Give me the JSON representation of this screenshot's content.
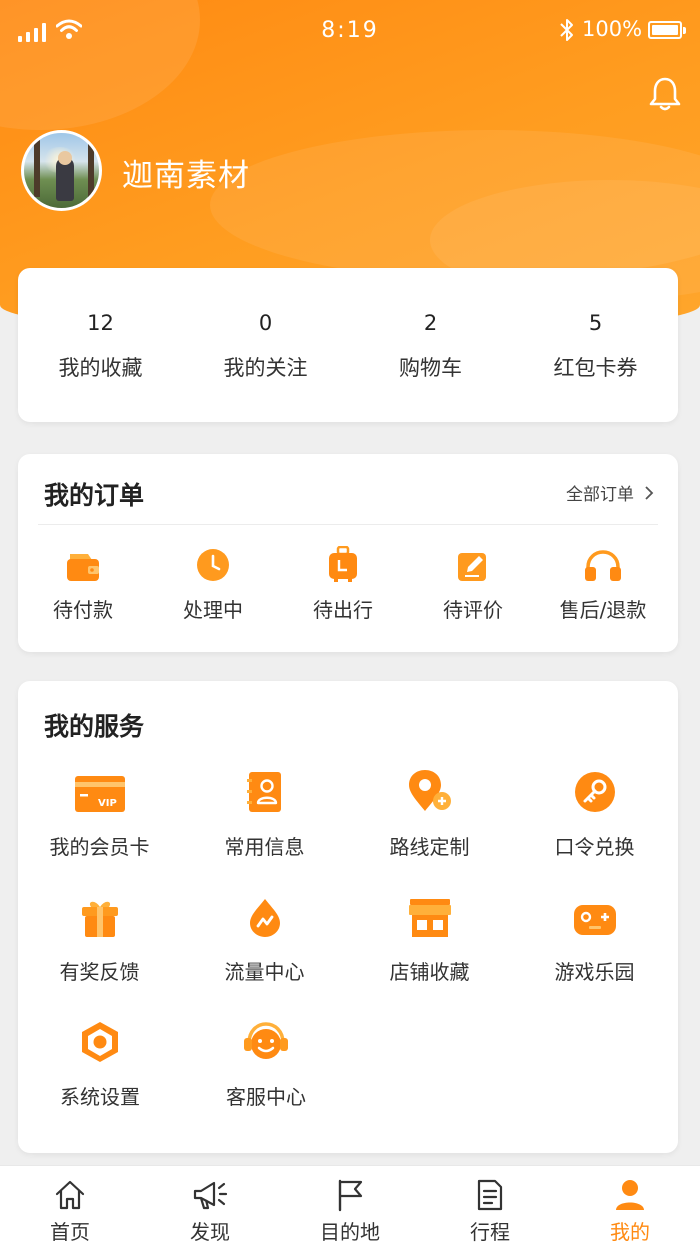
{
  "status_bar": {
    "time": "8:19",
    "battery": "100%"
  },
  "profile": {
    "username": "迦南素材"
  },
  "stats": [
    {
      "count": "12",
      "label": "我的收藏"
    },
    {
      "count": "0",
      "label": "我的关注"
    },
    {
      "count": "2",
      "label": "购物车"
    },
    {
      "count": "5",
      "label": "红包卡券"
    }
  ],
  "orders": {
    "title": "我的订单",
    "all_label": "全部订单",
    "items": [
      {
        "label": "待付款",
        "icon": "wallet-icon"
      },
      {
        "label": "处理中",
        "icon": "clock-icon"
      },
      {
        "label": "待出行",
        "icon": "luggage-icon"
      },
      {
        "label": "待评价",
        "icon": "edit-icon"
      },
      {
        "label": "售后/退款",
        "icon": "headphones-icon"
      }
    ]
  },
  "services": {
    "title": "我的服务",
    "items": [
      {
        "label": "我的会员卡",
        "icon": "vip-card-icon"
      },
      {
        "label": "常用信息",
        "icon": "contacts-icon"
      },
      {
        "label": "路线定制",
        "icon": "route-pin-icon"
      },
      {
        "label": "口令兑换",
        "icon": "key-icon"
      },
      {
        "label": "有奖反馈",
        "icon": "gift-icon"
      },
      {
        "label": "流量中心",
        "icon": "data-flow-icon"
      },
      {
        "label": "店铺收藏",
        "icon": "store-icon"
      },
      {
        "label": "游戏乐园",
        "icon": "gamepad-icon"
      },
      {
        "label": "系统设置",
        "icon": "settings-hex-icon"
      },
      {
        "label": "客服中心",
        "icon": "customer-service-icon"
      }
    ]
  },
  "tabbar": [
    {
      "label": "首页",
      "icon": "home-icon",
      "active": false
    },
    {
      "label": "发现",
      "icon": "megaphone-icon",
      "active": false
    },
    {
      "label": "目的地",
      "icon": "flag-icon",
      "active": false
    },
    {
      "label": "行程",
      "icon": "document-icon",
      "active": false
    },
    {
      "label": "我的",
      "icon": "person-icon",
      "active": true
    }
  ],
  "colors": {
    "accent": "#ff8a12",
    "accent_light": "#ffb03a",
    "background": "#efefef"
  }
}
